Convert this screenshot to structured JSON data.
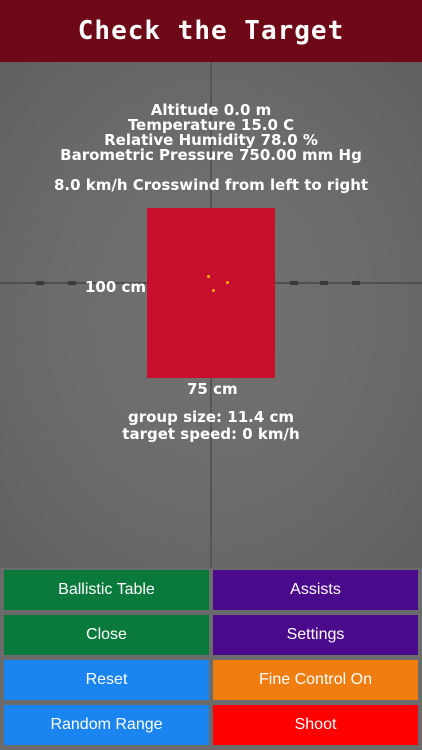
{
  "header": {
    "title": "Check the Target"
  },
  "conditions": {
    "altitude": "Altitude 0.0 m",
    "temperature": "Temperature 15.0 C",
    "humidity": "Relative Humidity 78.0 %",
    "pressure": "Barometric Pressure 750.00 mm Hg",
    "wind": "8.0 km/h Crosswind from left to right"
  },
  "target": {
    "height_label": "100 cm",
    "width_label": "75 cm",
    "color": "#c8102e",
    "hit_color": "#ffb300"
  },
  "stats": {
    "group_size": "group size: 11.4 cm",
    "target_speed": "target speed: 0 km/h"
  },
  "buttons": {
    "ballistic_table": {
      "label": "Ballistic Table",
      "color": "#0a7a3c"
    },
    "assists": {
      "label": "Assists",
      "color": "#4b0a8c"
    },
    "close": {
      "label": "Close",
      "color": "#0a7a3c"
    },
    "settings": {
      "label": "Settings",
      "color": "#4b0a8c"
    },
    "reset": {
      "label": "Reset",
      "color": "#1a84f0"
    },
    "fine_control": {
      "label": "Fine Control On",
      "color": "#f07d10"
    },
    "random_range": {
      "label": "Random Range",
      "color": "#1a84f0"
    },
    "shoot": {
      "label": "Shoot",
      "color": "#ff0000"
    }
  }
}
